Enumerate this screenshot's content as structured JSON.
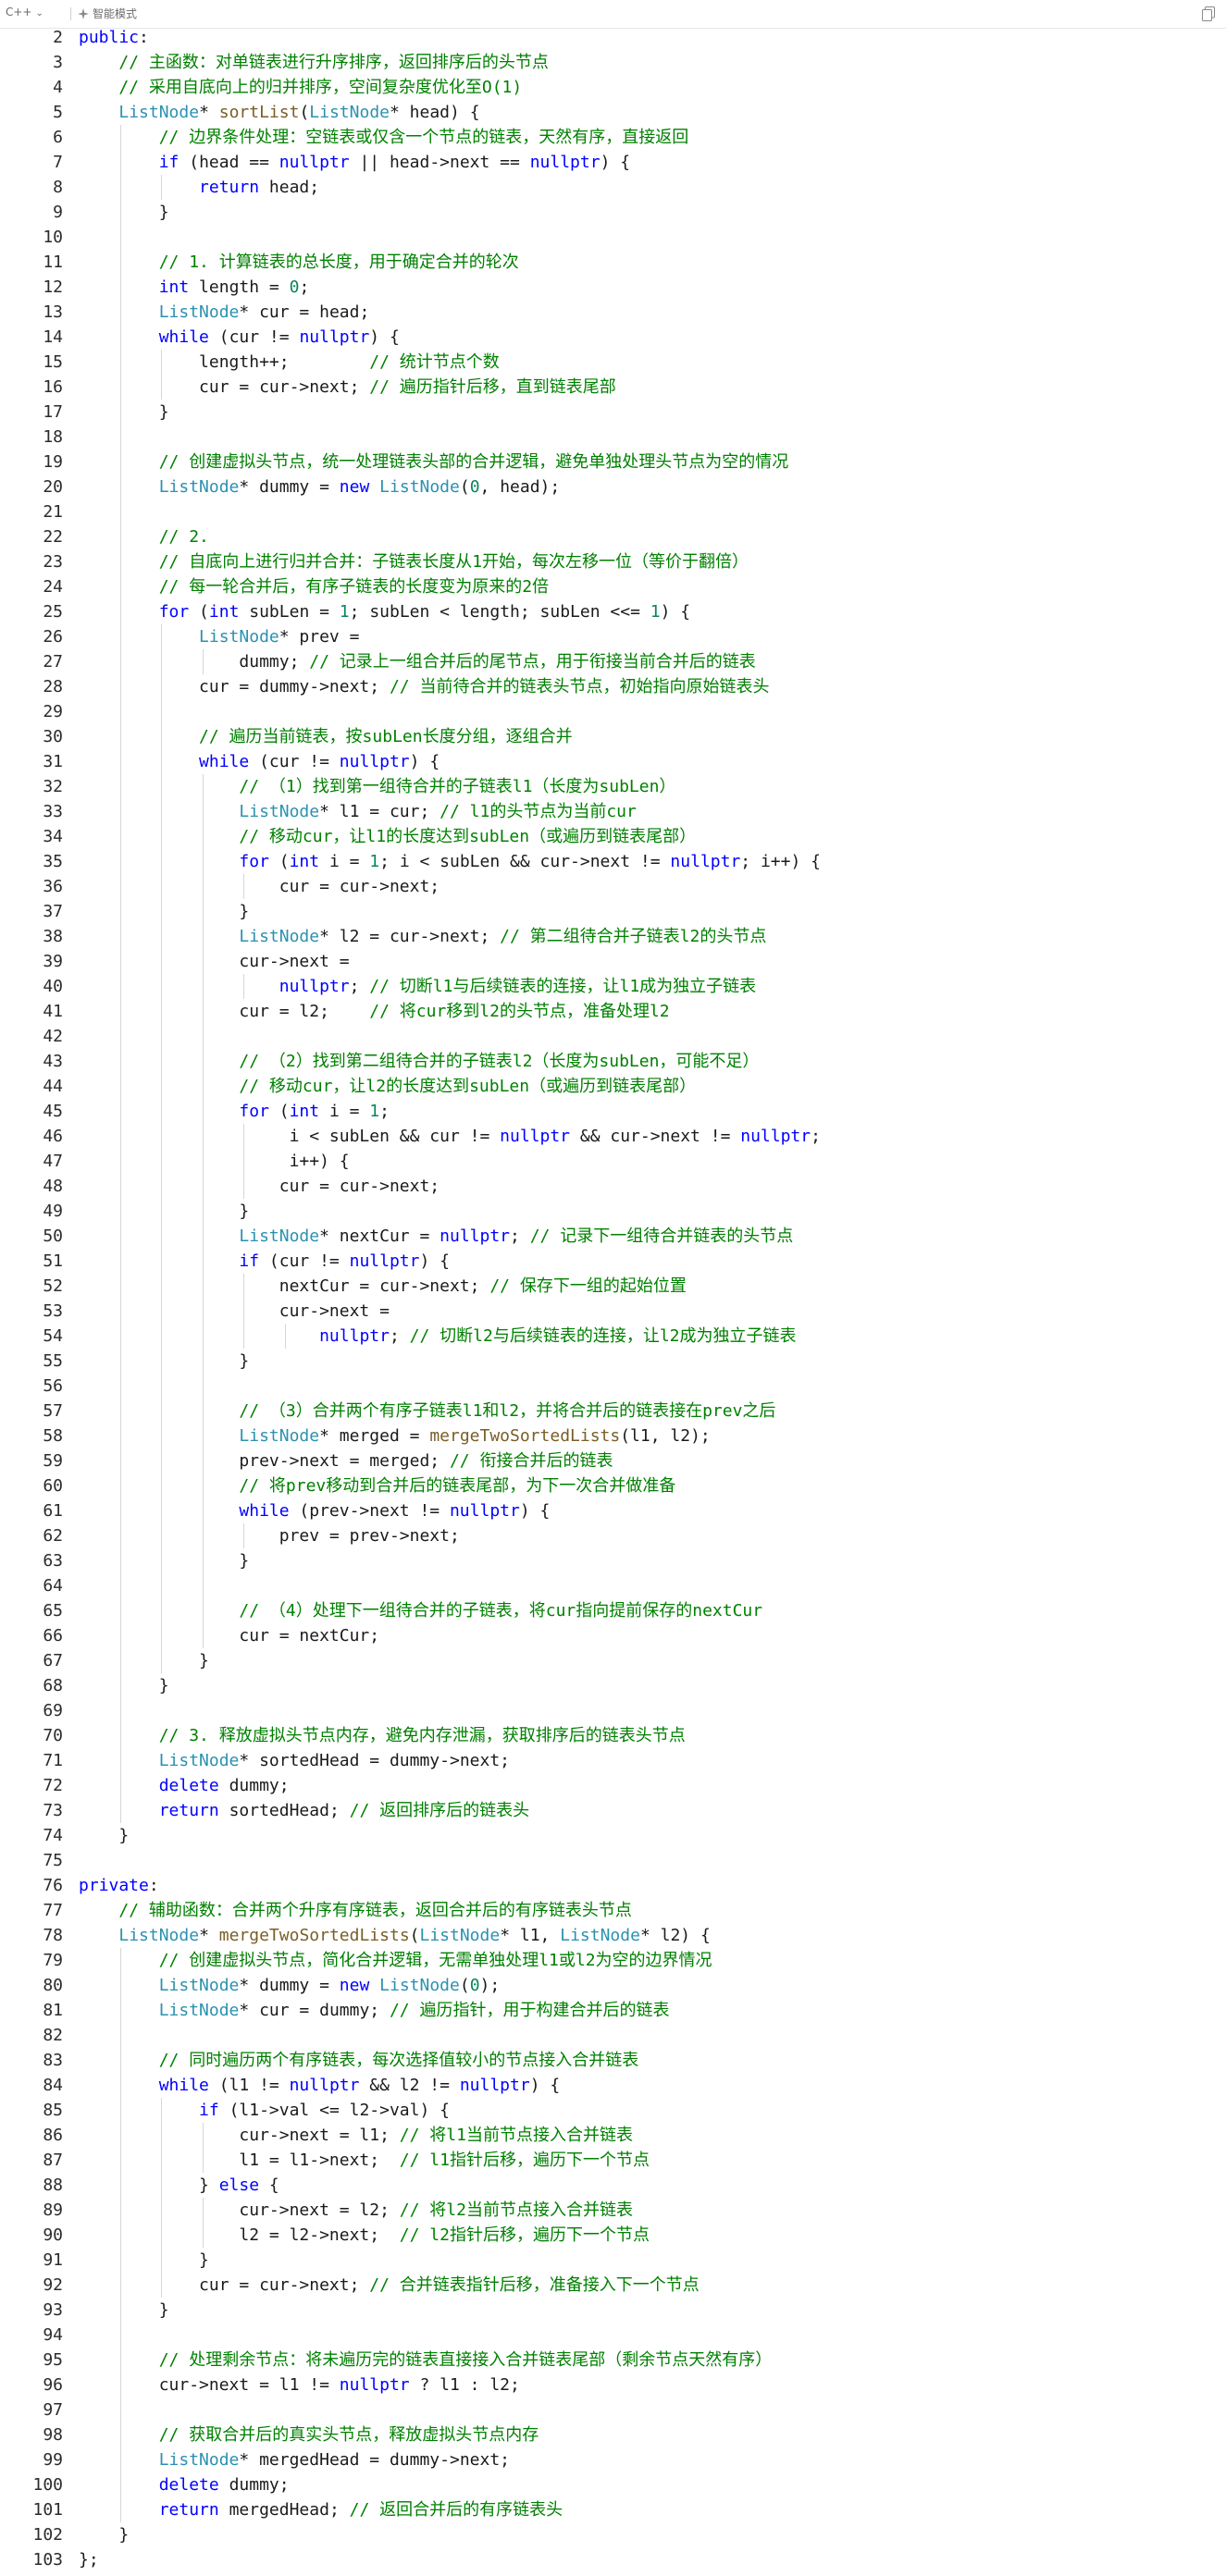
{
  "toolbar": {
    "language": "C++",
    "mode_label": "智能模式"
  },
  "code": {
    "first_line_number": 2,
    "lines": [
      "public:",
      "    // 主函数：对单链表进行升序排序，返回排序后的头节点",
      "    // 采用自底向上的归并排序，空间复杂度优化至O(1)",
      "    ListNode* sortList(ListNode* head) {",
      "        // 边界条件处理：空链表或仅含一个节点的链表，天然有序，直接返回",
      "        if (head == nullptr || head->next == nullptr) {",
      "            return head;",
      "        }",
      "",
      "        // 1. 计算链表的总长度，用于确定合并的轮次",
      "        int length = 0;",
      "        ListNode* cur = head;",
      "        while (cur != nullptr) {",
      "            length++;        // 统计节点个数",
      "            cur = cur->next; // 遍历指针后移，直到链表尾部",
      "        }",
      "",
      "        // 创建虚拟头节点，统一处理链表头部的合并逻辑，避免单独处理头节点为空的情况",
      "        ListNode* dummy = new ListNode(0, head);",
      "",
      "        // 2.",
      "        // 自底向上进行归并合并：子链表长度从1开始，每次左移一位（等价于翻倍）",
      "        // 每一轮合并后，有序子链表的长度变为原来的2倍",
      "        for (int subLen = 1; subLen < length; subLen <<= 1) {",
      "            ListNode* prev =",
      "                dummy; // 记录上一组合并后的尾节点，用于衔接当前合并后的链表",
      "            cur = dummy->next; // 当前待合并的链表头节点，初始指向原始链表头",
      "",
      "            // 遍历当前链表，按subLen长度分组，逐组合并",
      "            while (cur != nullptr) {",
      "                // （1）找到第一组待合并的子链表l1（长度为subLen）",
      "                ListNode* l1 = cur; // l1的头节点为当前cur",
      "                // 移动cur，让l1的长度达到subLen（或遍历到链表尾部）",
      "                for (int i = 1; i < subLen && cur->next != nullptr; i++) {",
      "                    cur = cur->next;",
      "                }",
      "                ListNode* l2 = cur->next; // 第二组待合并子链表l2的头节点",
      "                cur->next =",
      "                    nullptr; // 切断l1与后续链表的连接，让l1成为独立子链表",
      "                cur = l2;    // 将cur移到l2的头节点，准备处理l2",
      "",
      "                // （2）找到第二组待合并的子链表l2（长度为subLen，可能不足）",
      "                // 移动cur，让l2的长度达到subLen（或遍历到链表尾部）",
      "                for (int i = 1;",
      "                     i < subLen && cur != nullptr && cur->next != nullptr;",
      "                     i++) {",
      "                    cur = cur->next;",
      "                }",
      "                ListNode* nextCur = nullptr; // 记录下一组待合并链表的头节点",
      "                if (cur != nullptr) {",
      "                    nextCur = cur->next; // 保存下一组的起始位置",
      "                    cur->next =",
      "                        nullptr; // 切断l2与后续链表的连接，让l2成为独立子链表",
      "                }",
      "",
      "                // （3）合并两个有序子链表l1和l2，并将合并后的链表接在prev之后",
      "                ListNode* merged = mergeTwoSortedLists(l1, l2);",
      "                prev->next = merged; // 衔接合并后的链表",
      "                // 将prev移动到合并后的链表尾部，为下一次合并做准备",
      "                while (prev->next != nullptr) {",
      "                    prev = prev->next;",
      "                }",
      "",
      "                // （4）处理下一组待合并的子链表，将cur指向提前保存的nextCur",
      "                cur = nextCur;",
      "            }",
      "        }",
      "",
      "        // 3. 释放虚拟头节点内存，避免内存泄漏，获取排序后的链表头节点",
      "        ListNode* sortedHead = dummy->next;",
      "        delete dummy;",
      "        return sortedHead; // 返回排序后的链表头",
      "    }",
      "",
      "private:",
      "    // 辅助函数：合并两个升序有序链表，返回合并后的有序链表头节点",
      "    ListNode* mergeTwoSortedLists(ListNode* l1, ListNode* l2) {",
      "        // 创建虚拟头节点，简化合并逻辑，无需单独处理l1或l2为空的边界情况",
      "        ListNode* dummy = new ListNode(0);",
      "        ListNode* cur = dummy; // 遍历指针，用于构建合并后的链表",
      "",
      "        // 同时遍历两个有序链表，每次选择值较小的节点接入合并链表",
      "        while (l1 != nullptr && l2 != nullptr) {",
      "            if (l1->val <= l2->val) {",
      "                cur->next = l1; // 将l1当前节点接入合并链表",
      "                l1 = l1->next;  // l1指针后移，遍历下一个节点",
      "            } else {",
      "                cur->next = l2; // 将l2当前节点接入合并链表",
      "                l2 = l2->next;  // l2指针后移，遍历下一个节点",
      "            }",
      "            cur = cur->next; // 合并链表指针后移，准备接入下一个节点",
      "        }",
      "",
      "        // 处理剩余节点：将未遍历完的链表直接接入合并链表尾部（剩余节点天然有序）",
      "        cur->next = l1 != nullptr ? l1 : l2;",
      "",
      "        // 获取合并后的真实头节点，释放虚拟头节点内存",
      "        ListNode* mergedHead = dummy->next;",
      "        delete dummy;",
      "        return mergedHead; // 返回合并后的有序链表头",
      "    }",
      "};"
    ]
  }
}
